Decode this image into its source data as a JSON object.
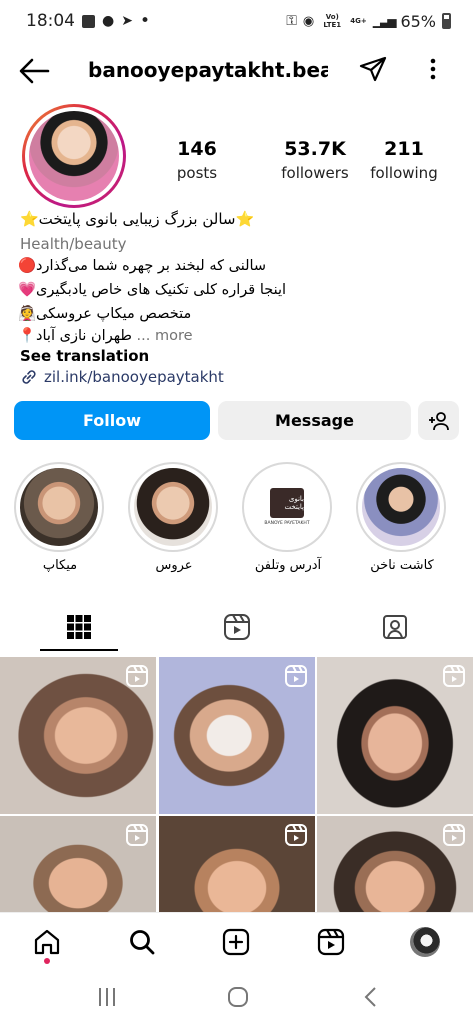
{
  "status_bar": {
    "time": "18:04",
    "dot": "•",
    "network": "4G+",
    "volte": "Vo) LTE1",
    "battery": "65%"
  },
  "header": {
    "username": "banooyepaytakht.bea..."
  },
  "profile": {
    "stats": [
      {
        "value": "146",
        "label": "posts"
      },
      {
        "value": "53.7K",
        "label": "followers"
      },
      {
        "value": "211",
        "label": "following"
      }
    ],
    "name": "⭐سالن بزرگ زیبایی بانوی پایتخت⭐",
    "category": "Health/beauty",
    "bio_lines": [
      "سالنی که لبخند بر چهره شما می‌گذارد🔴",
      "اینجا قراره کلی تکنیک های خاص یادبگیری💗",
      "متخصص میکاپ عروسکی👰"
    ],
    "bio_last": "طهران نازی آباد📍",
    "more_label": "... more",
    "see_translation": "See translation",
    "link": "zil.ink/banooyepaytakht"
  },
  "actions": {
    "follow": "Follow",
    "message": "Message"
  },
  "highlights": [
    {
      "label": "میکاپ"
    },
    {
      "label": "عروس"
    },
    {
      "label": "آدرس وتلفن"
    },
    {
      "label": "کاشت ناخن"
    }
  ],
  "highlight_logo_text": "بانوی پایتخت",
  "highlight_logo_sub": "BANOYE PAYETAKHT",
  "colors": {
    "accent": "#0095f6",
    "button_bg": "#efefef",
    "muted": "#737373"
  }
}
